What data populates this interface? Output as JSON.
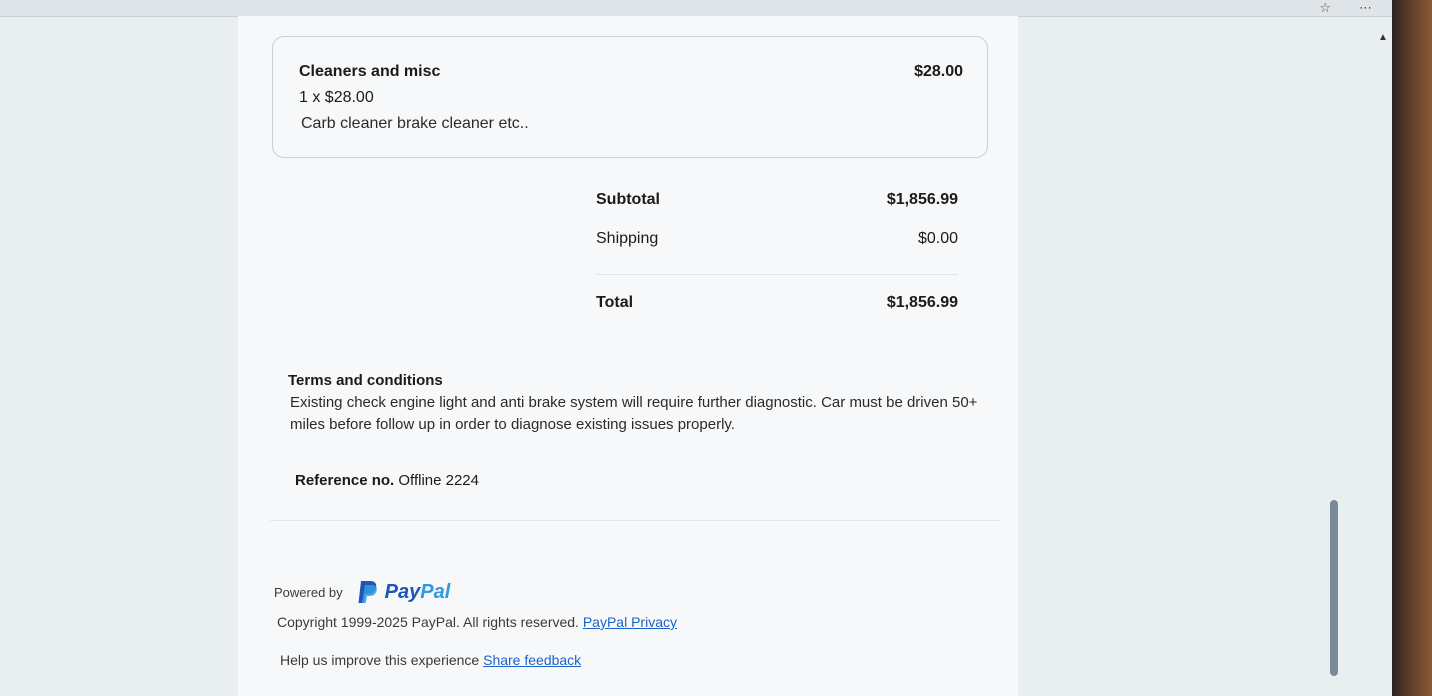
{
  "item": {
    "name": "Cleaners and misc",
    "line_total": "$28.00",
    "qty_price": "1 x $28.00",
    "description": "Carb cleaner brake cleaner etc.."
  },
  "summary": {
    "subtotal_label": "Subtotal",
    "subtotal_value": "$1,856.99",
    "shipping_label": "Shipping",
    "shipping_value": "$0.00",
    "total_label": "Total",
    "total_value": "$1,856.99"
  },
  "terms": {
    "title": "Terms and conditions",
    "body": "Existing check engine light and anti brake system will require further diagnostic. Car must be driven 50+ miles before follow up in order to diagnose existing issues properly."
  },
  "reference": {
    "label": "Reference no.",
    "value": "Offline 2224"
  },
  "footer": {
    "powered_by": "Powered by",
    "brand_a": "Pay",
    "brand_b": "Pal",
    "copyright": "Copyright 1999-2025 PayPal. All rights reserved.",
    "privacy_link": "PayPal Privacy",
    "feedback_text": "Help us improve this experience",
    "feedback_link": "Share feedback"
  },
  "icons": {
    "browser_star": "star-icon",
    "scroll_up": "chevron-up-icon",
    "paypal_mark": "paypal-logo-icon"
  },
  "colors": {
    "link": "#1d62c9",
    "paypal_dark": "#1e56b8",
    "paypal_light": "#2f9ae0"
  }
}
